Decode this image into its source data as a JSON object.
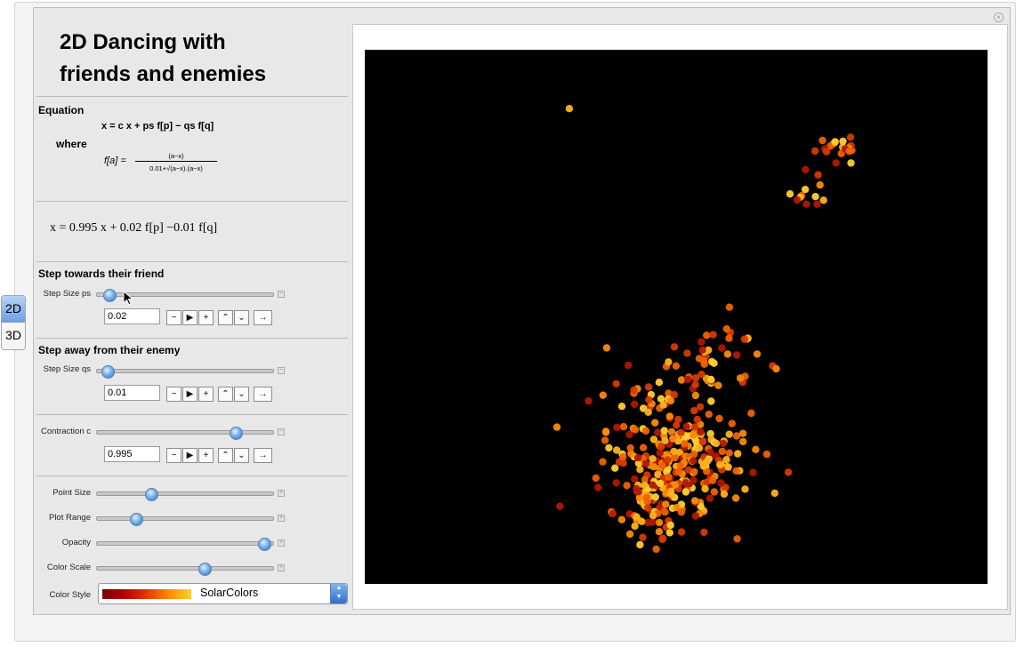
{
  "title_line1": "2D Dancing with",
  "title_line2": "friends and enemies",
  "views": [
    "2D",
    "3D"
  ],
  "active_view": "2D",
  "equation": {
    "heading": "Equation",
    "main": "x = c x + ps f[p] − qs f[q]",
    "where": "where",
    "f_lhs": "f[a] =",
    "f_num": "(a−x)",
    "f_den": "0.01+√(a−x).(a−x)",
    "current": "x = 0.995 x + 0.02  f[p] −0.01 f[q]"
  },
  "friend": {
    "heading": "Step towards their friend",
    "label": "Step Size ps",
    "value": "0.02",
    "fraction": 0.07
  },
  "enemy": {
    "heading": "Step away from their enemy",
    "label": "Step Size qs",
    "value": "0.01",
    "fraction": 0.06
  },
  "contraction": {
    "label": "Contraction c",
    "value": "0.995",
    "fraction": 0.79
  },
  "buttons": {
    "minus": "−",
    "play": "▶",
    "plus": "+",
    "faster": "⌃",
    "slower": "⌄",
    "direction": "→"
  },
  "point_size": {
    "label": "Point Size",
    "fraction": 0.31
  },
  "plot_range": {
    "label": "Plot Range",
    "fraction": 0.22
  },
  "opacity": {
    "label": "Opacity",
    "fraction": 0.95
  },
  "color_scale": {
    "label": "Color Scale",
    "fraction": 0.61
  },
  "color_style": {
    "label": "Color Style",
    "value": "SolarColors"
  },
  "icons": {
    "close": "close-icon",
    "cursor": "pointer-cursor-icon",
    "toggle": "plus-minus-icon",
    "dropdown": "updown-arrows-icon"
  },
  "colors": {
    "plot_background": "#000000",
    "point_palette": [
      "#b01800",
      "#d63a00",
      "#ee6200",
      "#f98a0a",
      "#ffb21c",
      "#ffd030"
    ]
  },
  "chart_data": {
    "type": "scatter",
    "title": "",
    "xlabel": "",
    "ylabel": "",
    "grid": false,
    "clusters": [
      {
        "cx": 0.33,
        "cy": 0.885,
        "spread": 0.005,
        "count": 1
      },
      {
        "cx": 0.76,
        "cy": 0.82,
        "spread": 0.018,
        "count": 18
      },
      {
        "cx": 0.715,
        "cy": 0.735,
        "spread": 0.02,
        "count": 12
      },
      {
        "cx": 0.587,
        "cy": 0.53,
        "spread": 0.005,
        "count": 1
      },
      {
        "cx": 0.555,
        "cy": 0.4,
        "spread": 0.04,
        "count": 45
      },
      {
        "cx": 0.45,
        "cy": 0.34,
        "spread": 0.04,
        "count": 30
      },
      {
        "cx": 0.5,
        "cy": 0.23,
        "spread": 0.055,
        "count": 230
      },
      {
        "cx": 0.46,
        "cy": 0.15,
        "spread": 0.03,
        "count": 70
      }
    ],
    "xlim": [
      0,
      1
    ],
    "ylim": [
      0,
      1
    ]
  }
}
